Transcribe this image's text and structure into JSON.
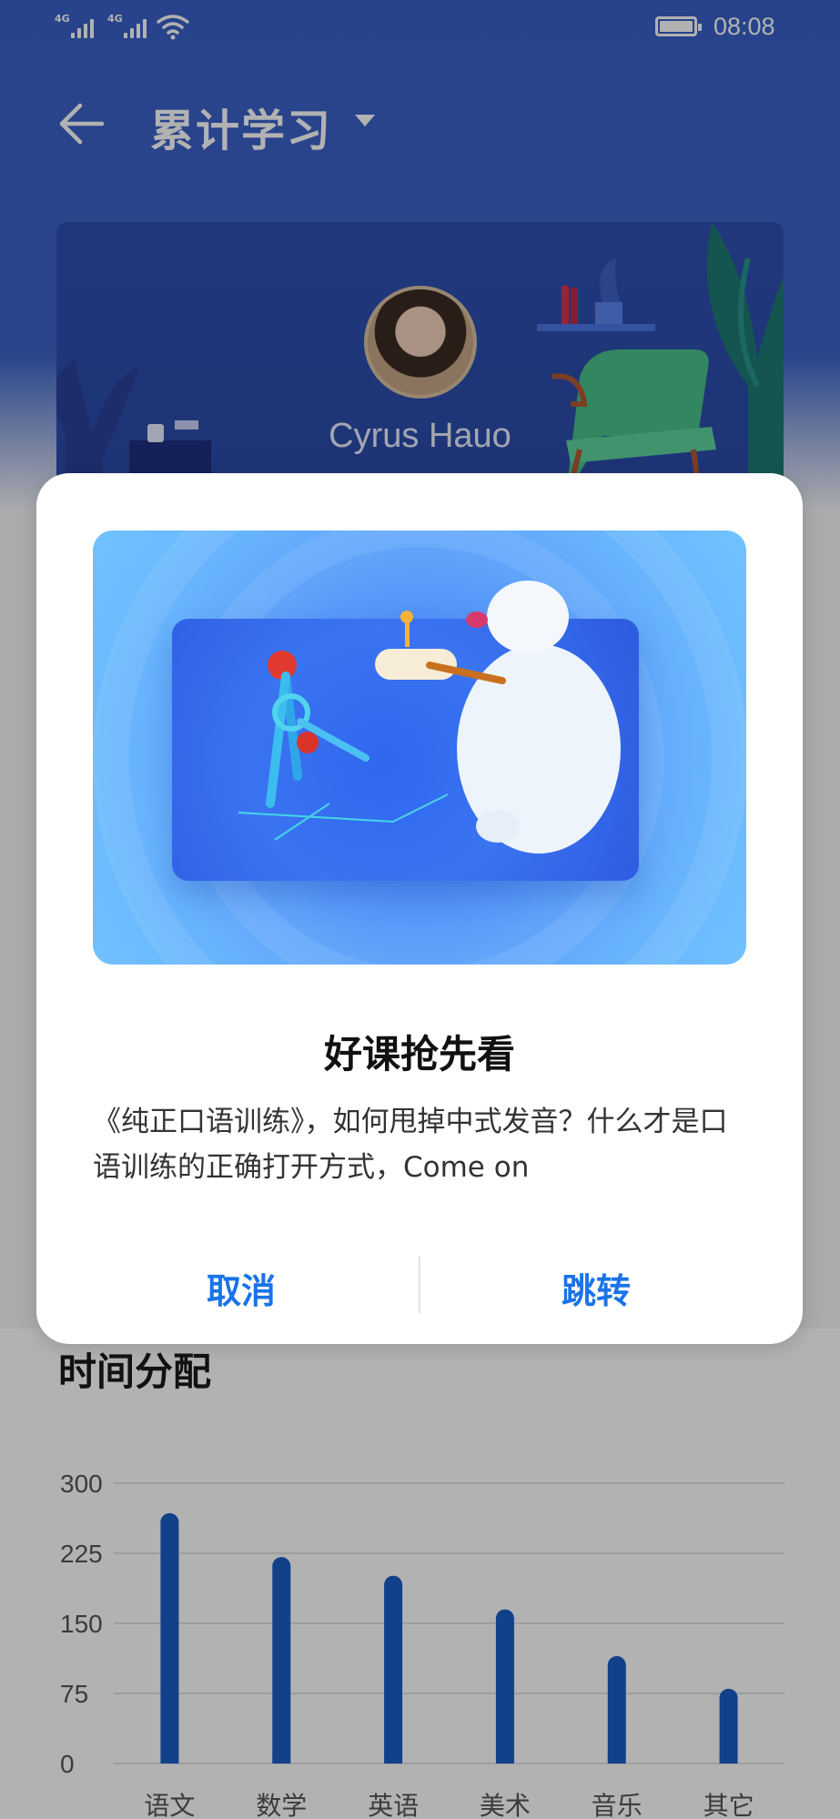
{
  "status_bar": {
    "sim1": "4G",
    "sim2": "4G",
    "time": "08:08"
  },
  "navbar": {
    "title": "累计学习"
  },
  "profile": {
    "name": "Cyrus Hauo"
  },
  "chart_section": {
    "title": "时间分配"
  },
  "chart_data": {
    "type": "bar",
    "title": "时间分配",
    "categories": [
      "语文",
      "数学",
      "英语",
      "美术",
      "音乐",
      "其它"
    ],
    "values": [
      268,
      221,
      201,
      165,
      115,
      80
    ],
    "ylim": [
      0,
      300
    ],
    "yticks": [
      "0",
      "75",
      "150",
      "225",
      "300"
    ],
    "grid": true,
    "bar_color": "#1a5cc4"
  },
  "dialog": {
    "title": "好课抢先看",
    "message": "《纯正口语训练》，如何甩掉中式发音？什么才是口语训练的正确打开方式，Come on",
    "cancel_label": "取消",
    "confirm_label": "跳转",
    "accent_color": "#1a73e8"
  }
}
